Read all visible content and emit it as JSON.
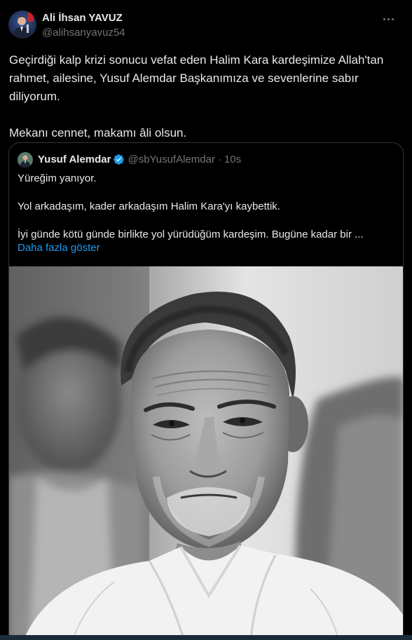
{
  "author": {
    "name": "Ali İhsan YAVUZ",
    "handle": "@alihsanyavuz54"
  },
  "tweet": {
    "text": "Geçirdiği kalp krizi sonucu vefat eden Halim Kara kardeşimize Allah'tan rahmet, ailesine, Yusuf Alemdar Başkanımıza ve sevenlerine sabır diliyorum.\n\nMekanı cennet, makamı âli olsun."
  },
  "quote": {
    "name": "Yusuf Alemdar",
    "handle": "@sbYusufAlemdar",
    "separator": "·",
    "time": "10s",
    "text": "Yüreğim yanıyor.\n\nYol arkadaşım, kader arkadaşım Halim Kara'yı kaybettik.\n\nİyi günde kötü günde birlikte yol yürüdüğüm kardeşim. Bugüne kadar bir ...",
    "show_more": "Daha fazla göster"
  },
  "icons": {
    "more": "more-horizontal-icon",
    "verified": "verified-badge-icon"
  },
  "colors": {
    "background": "#000000",
    "text": "#e7e9ea",
    "secondary": "#71767b",
    "link": "#1d9bf0",
    "border": "#2f3336"
  }
}
